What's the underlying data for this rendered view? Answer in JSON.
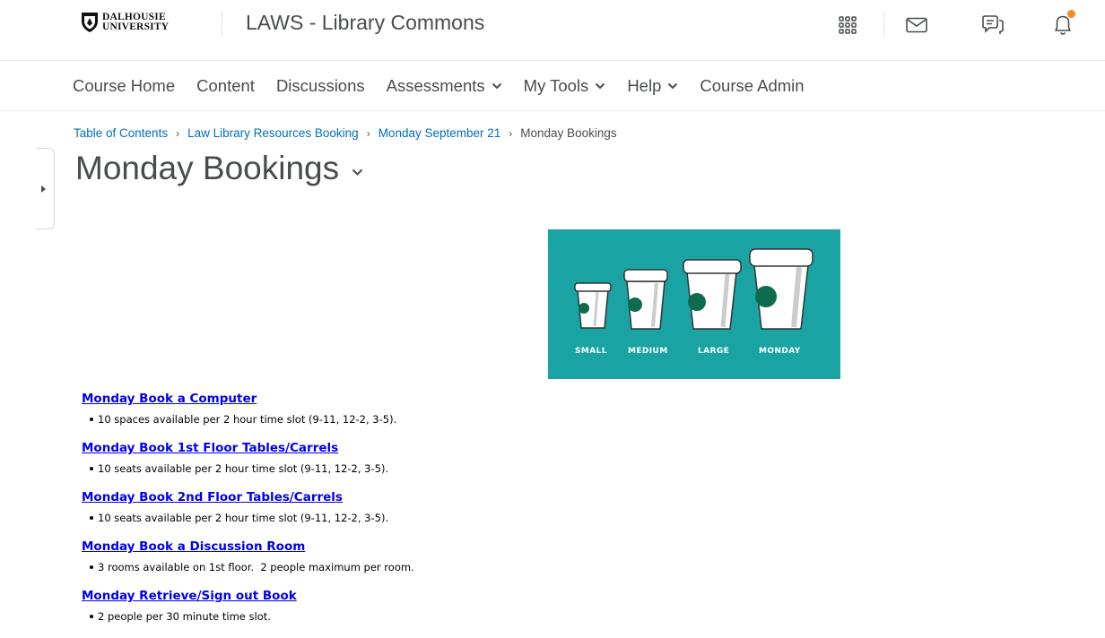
{
  "header": {
    "logo_line1": "DALHOUSIE",
    "logo_line2": "UNIVERSITY",
    "course_title": "LAWS - Library Commons",
    "icons": [
      "grid-icon",
      "mail-icon",
      "chat-icon",
      "bell-icon"
    ],
    "notification_color": "#f68c16"
  },
  "nav": {
    "items": [
      {
        "label": "Course Home",
        "dropdown": false
      },
      {
        "label": "Content",
        "dropdown": false
      },
      {
        "label": "Discussions",
        "dropdown": false
      },
      {
        "label": "Assessments",
        "dropdown": true
      },
      {
        "label": "My Tools",
        "dropdown": true
      },
      {
        "label": "Help",
        "dropdown": true
      },
      {
        "label": "Course Admin",
        "dropdown": false
      }
    ]
  },
  "breadcrumb": {
    "links": [
      "Table of Contents",
      "Law Library Resources Booking",
      "Monday September 21"
    ],
    "current": "Monday Bookings"
  },
  "page": {
    "title": "Monday Bookings"
  },
  "image": {
    "background": "#1aa3a3",
    "labels": [
      "SMALL",
      "MEDIUM",
      "LARGE",
      "MONDAY"
    ]
  },
  "bookings": [
    {
      "link": "Monday Book a Computer",
      "desc": "10 spaces available per 2 hour time slot (9-11, 12-2, 3-5)."
    },
    {
      "link": "Monday Book 1st Floor Tables/Carrels",
      "desc": "10 seats available per 2 hour time slot (9-11, 12-2, 3-5)."
    },
    {
      "link": "Monday Book 2nd Floor Tables/Carrels",
      "desc": "10 seats available per 2 hour time slot (9-11, 12-2, 3-5)."
    },
    {
      "link": "Monday Book a Discussion Room",
      "desc": "3 rooms available on 1st floor.  2 people maximum per room."
    },
    {
      "link": "Monday Retrieve/Sign out Book",
      "desc": "2 people per 30 minute time slot."
    }
  ]
}
